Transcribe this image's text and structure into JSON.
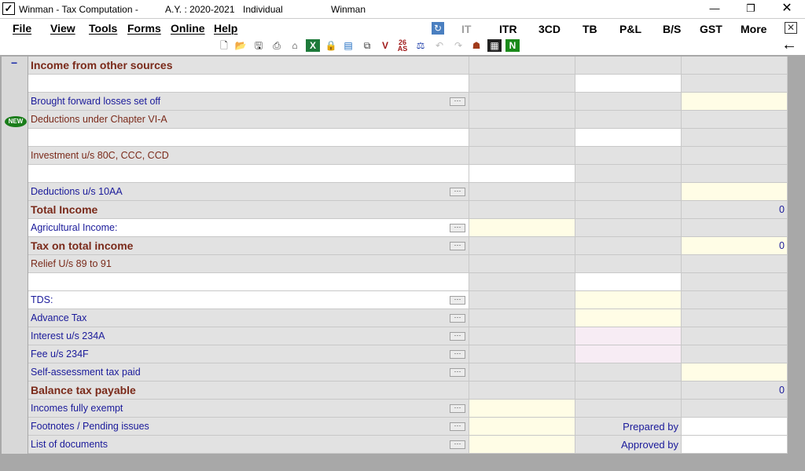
{
  "window": {
    "title": "Winman - Tax Computation -",
    "ay": "A.Y. : 2020-2021",
    "status": "Individual",
    "user": "Winman"
  },
  "menu": [
    "File",
    "View",
    "Tools",
    "Forms",
    "Online",
    "Help"
  ],
  "right_menu": [
    "IT",
    "ITR",
    "3CD",
    "TB",
    "P&L",
    "B/S",
    "GST",
    "More"
  ],
  "sections": {
    "income_other_sources": "Income from other sources",
    "bf_losses": "Brought forward losses set off",
    "chapter_via": "Deductions under Chapter VI-A",
    "inv_80c": "Investment u/s 80C, CCC, CCD",
    "ded_10aa": "Deductions u/s 10AA",
    "total_income": "Total Income",
    "total_income_val": "0",
    "agri_income": "Agricultural Income:",
    "tax_total_income": "Tax on total income",
    "tax_total_income_val": "0",
    "relief": "Relief U/s 89 to 91",
    "tds": "TDS:",
    "advance_tax": "Advance Tax",
    "int_234a": "Interest u/s 234A",
    "fee_234f": "Fee u/s 234F",
    "self_assess": "Self-assessment tax paid",
    "balance_tax": "Balance tax payable",
    "balance_tax_val": "0",
    "exempt": "Incomes fully exempt",
    "footnotes": "Footnotes / Pending issues",
    "prepared_by": "Prepared by",
    "docs": "List of documents",
    "approved_by": "Approved by"
  },
  "new_badge": "NEW",
  "collapse_symbol": "−",
  "dots_symbol": "···",
  "colors": {
    "label_blue": "#1a1a9a",
    "label_maroon": "#7a2a1a",
    "cell_yellow": "#fffde6",
    "cell_pink": "#f7ecf4",
    "cell_gray": "#e2e2e2"
  }
}
